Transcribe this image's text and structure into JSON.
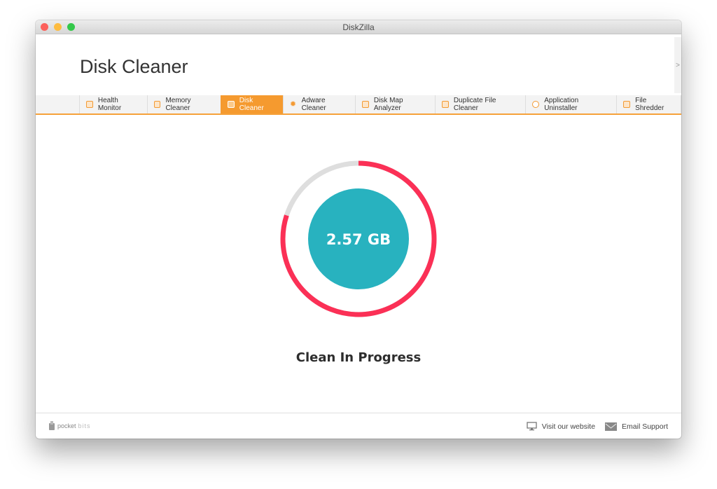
{
  "window": {
    "title": "DiskZilla"
  },
  "header": {
    "page_title": "Disk Cleaner",
    "side_handle": ">"
  },
  "tabs": [
    {
      "label": "Health Monitor",
      "icon": "health-monitor-icon",
      "active": false
    },
    {
      "label": "Memory Cleaner",
      "icon": "monitor-icon",
      "active": false
    },
    {
      "label": "Disk Cleaner",
      "icon": "disk-icon",
      "active": true
    },
    {
      "label": "Adware Cleaner",
      "icon": "bug-icon",
      "active": false
    },
    {
      "label": "Disk Map Analyzer",
      "icon": "chart-icon",
      "active": false
    },
    {
      "label": "Duplicate File Cleaner",
      "icon": "duplicate-icon",
      "active": false
    },
    {
      "label": "Application Uninstaller",
      "icon": "gear-icon",
      "active": false
    },
    {
      "label": "File Shredder",
      "icon": "shredder-icon",
      "active": false
    }
  ],
  "progress": {
    "size_label": "2.57 GB",
    "percent": 80,
    "status": "Clean In Progress",
    "colors": {
      "progress": "#fb3056",
      "track": "#dedede",
      "center": "#28b2bf"
    }
  },
  "footer": {
    "brand_prefix": "pocket",
    "brand_suffix": "bits",
    "visit_website": "Visit our website",
    "email_support": "Email Support"
  },
  "colors": {
    "accent": "#f59a2f"
  }
}
